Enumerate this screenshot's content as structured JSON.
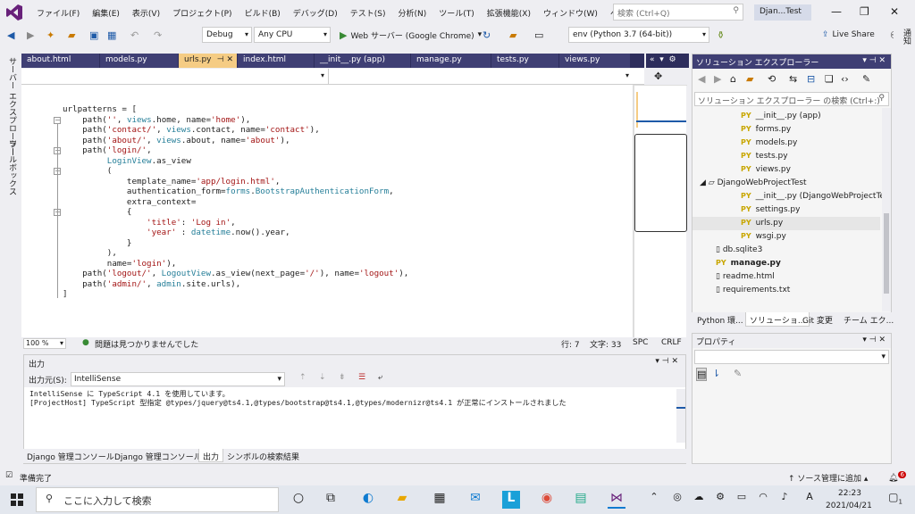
{
  "menubar": {
    "items": [
      "ファイル(F)",
      "編集(E)",
      "表示(V)",
      "プロジェクト(P)",
      "ビルド(B)",
      "デバッグ(D)",
      "テスト(S)",
      "分析(N)",
      "ツール(T)",
      "拡張機能(X)",
      "ウィンドウ(W)",
      "ヘルプ(H)"
    ],
    "search_placeholder": "検索 (Ctrl+Q)",
    "solution_name": "Djan...Test"
  },
  "toolbar": {
    "config": "Debug",
    "platform": "Any CPU",
    "run_target": "Web サーバー (Google Chrome)",
    "environment": "env (Python 3.7 (64-bit))",
    "live_share": "Live Share"
  },
  "left_strip": {
    "server_explorer": "サーバー エクスプローラー",
    "toolbox": "ツールボックス"
  },
  "tabs": [
    {
      "label": "about.html"
    },
    {
      "label": "models.py"
    },
    {
      "label": "urls.py",
      "active": true
    },
    {
      "label": "index.html"
    },
    {
      "label": "__init__.py (app)"
    },
    {
      "label": "manage.py"
    },
    {
      "label": "tests.py"
    },
    {
      "label": "views.py"
    }
  ],
  "editor": {
    "lines": [
      "urlpatterns = [",
      "    path('', views.home, name='home'),",
      "    path('contact/', views.contact, name='contact'),",
      "    path('about/', views.about, name='about'),",
      "    path('login/',",
      "         LoginView.as_view",
      "         (",
      "             template_name='app/login.html',",
      "             authentication_form=forms.BootstrapAuthenticationForm,",
      "             extra_context=",
      "             {",
      "                 'title': 'Log in',",
      "                 'year' : datetime.now().year,",
      "             }",
      "         ),",
      "         name='login'),",
      "    path('logout/', LogoutView.as_view(next_page='/'), name='logout'),",
      "    path('admin/', admin.site.urls),",
      "]"
    ],
    "zoom": "100 %",
    "no_issues": "問題は見つかりませんでした",
    "line": "行: 7",
    "col": "文字: 33",
    "spc": "SPC",
    "crlf": "CRLF"
  },
  "output": {
    "title": "出力",
    "source_label": "出力元(S):",
    "source_value": "IntelliSense",
    "lines": [
      "IntelliSense に TypeScript 4.1 を使用しています。",
      "[ProjectHost] TypeScript 型指定 @types/jquery@ts4.1,@types/bootstrap@ts4.1,@types/modernizr@ts4.1 が正常にインストールされました"
    ],
    "tabs": [
      "Django 管理コンソール",
      "Django 管理コンソール",
      "出力",
      "シンボルの検索結果"
    ]
  },
  "solution_explorer": {
    "title": "ソリューション エクスプローラー",
    "search_placeholder": "ソリューション エクスプローラー の検索 (Ctrl+:)",
    "items": [
      {
        "label": "__init__.py (app)",
        "type": "py",
        "indent": 1
      },
      {
        "label": "forms.py",
        "type": "py",
        "indent": 1
      },
      {
        "label": "models.py",
        "type": "py",
        "indent": 1
      },
      {
        "label": "tests.py",
        "type": "py",
        "indent": 1
      },
      {
        "label": "views.py",
        "type": "py",
        "indent": 1
      },
      {
        "label": "DjangoWebProjectTest",
        "type": "folder",
        "indent": 0
      },
      {
        "label": "__init__.py (DjangoWebProjectTes",
        "type": "py",
        "indent": 1
      },
      {
        "label": "settings.py",
        "type": "py",
        "indent": 1
      },
      {
        "label": "urls.py",
        "type": "py",
        "indent": 1,
        "selected": true
      },
      {
        "label": "wsgi.py",
        "type": "py",
        "indent": 1
      },
      {
        "label": "db.sqlite3",
        "type": "file",
        "indent": 0
      },
      {
        "label": "manage.py",
        "type": "py",
        "indent": 0,
        "bold": true
      },
      {
        "label": "readme.html",
        "type": "file",
        "indent": 0
      },
      {
        "label": "requirements.txt",
        "type": "file",
        "indent": 0
      }
    ],
    "tabs": [
      "Python 環...",
      "ソリューショ...",
      "Git 変更",
      "チーム エク..."
    ]
  },
  "properties": {
    "title": "プロパティ"
  },
  "right_strip": {
    "label": "通知"
  },
  "statusbar": {
    "ready": "準備完了",
    "source_control": "ソース管理に追加",
    "notifications": "6"
  },
  "taskbar": {
    "search_placeholder": "ここに入力して検索",
    "time": "22:23",
    "date": "2021/04/21",
    "lang": "A",
    "notif_count": "1"
  },
  "colors": {
    "accent": "#68217a",
    "tab_active": "#f5cc84",
    "tab_bar": "#2d2d5c",
    "string": "#a31515",
    "class": "#267f99"
  }
}
